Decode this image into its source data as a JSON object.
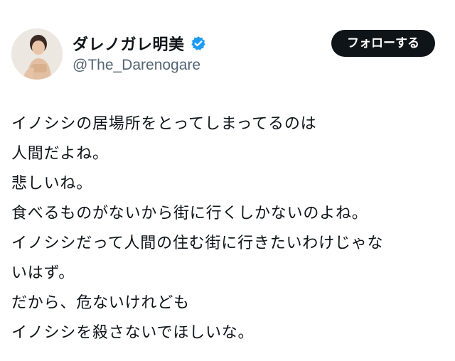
{
  "author": {
    "display_name": "ダレノガレ明美",
    "handle": "@The_Darenogare",
    "verified_icon": "verified-badge-icon",
    "verified_color": "#1d9bf0"
  },
  "follow_button": {
    "label": "フォローする",
    "background": "#0f1419",
    "color": "#ffffff"
  },
  "tweet": {
    "lines": [
      "イノシシの居場所をとってしまってるのは",
      "人間だよね。",
      "悲しいね。",
      "食べるものがないから街に行くしかないのよね。",
      "イノシシだって人間の住む街に行きたいわけじゃな",
      "いはず。",
      "だから、危ないけれども",
      "イノシシを殺さないでほしいな。"
    ]
  }
}
